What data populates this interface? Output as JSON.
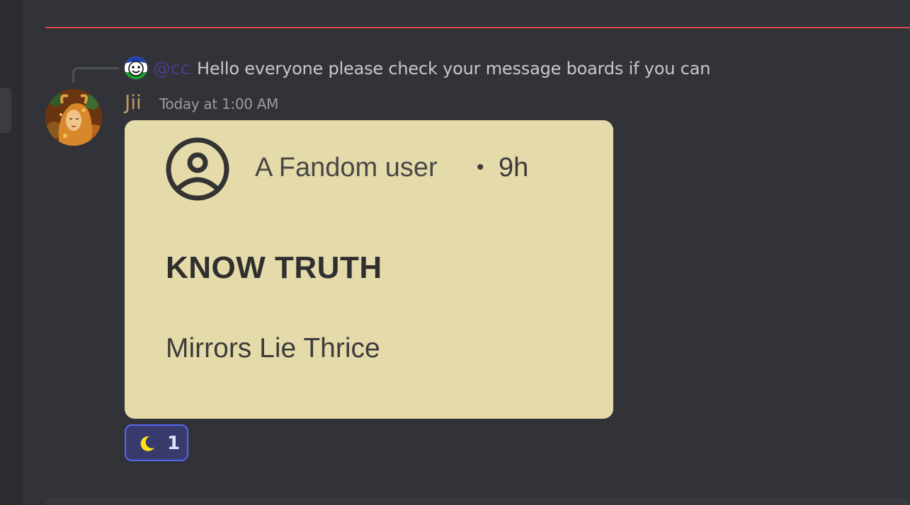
{
  "reply": {
    "mention": "@cc",
    "text": "Hello everyone please check your message boards if you can"
  },
  "message": {
    "author": "Jii",
    "timestamp": "Today at 1:00 AM",
    "author_color": "#c29765"
  },
  "attachment": {
    "author": "A Fandom user",
    "separator": "•",
    "age": "9h",
    "title": "KNOW TRUTH",
    "body": "Mirrors Lie Thrice",
    "background": "#e5daa9",
    "user_icon": "user-circle-icon"
  },
  "reaction": {
    "emoji": "crescent-moon-icon",
    "count": "1",
    "accent": "#5865f2"
  },
  "colors": {
    "background": "#313338",
    "new_messages_divider": "#e0464c",
    "mention": "#4c3d8f"
  }
}
